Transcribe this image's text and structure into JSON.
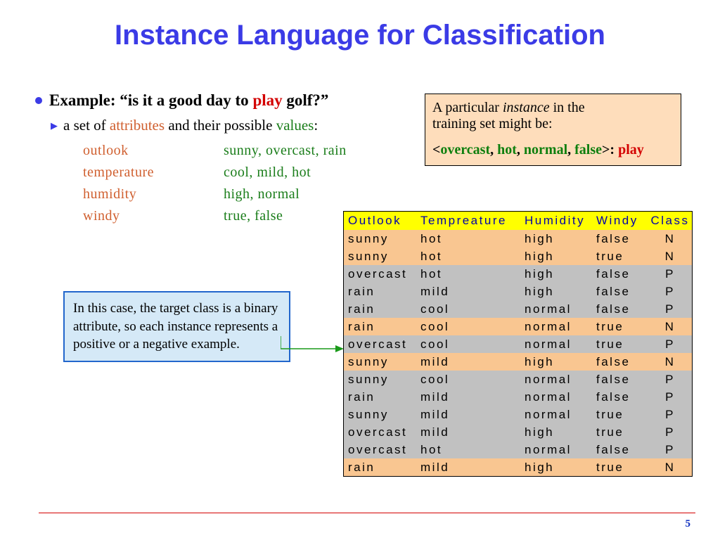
{
  "title": "Instance Language for Classification",
  "example": {
    "prefix": "Example: “is it a good day to ",
    "play": "play",
    "suffix": " golf?”"
  },
  "subline": {
    "p1": "a set of ",
    "attributes": "attributes",
    "p2": " and their possible ",
    "values": "values",
    "p3": ":"
  },
  "attrs": [
    {
      "name": "outlook",
      "vals": "sunny, overcast, rain"
    },
    {
      "name": "temperature",
      "vals": "cool, mild, hot"
    },
    {
      "name": "humidity",
      "vals": "high, normal"
    },
    {
      "name": "windy",
      "vals": "true, false"
    }
  ],
  "instance_box": {
    "l1a": "A particular ",
    "l1b": "instance",
    "l1c": " in the",
    "l2": "training set might be:",
    "bracket_open": "<",
    "vals": [
      "overcast",
      "hot",
      "normal",
      "false"
    ],
    "sep": ", ",
    "bracket_close": ">: ",
    "label": "play"
  },
  "note_box": "In this case, the target class is a binary attribute, so each instance represents a positive or a negative example.",
  "table": {
    "headers": [
      "Outlook",
      "Tempreature",
      "Humidity",
      "Windy",
      "Class"
    ],
    "rows": [
      {
        "c": [
          "sunny",
          "hot",
          "high",
          "false",
          "N"
        ],
        "band": "orange"
      },
      {
        "c": [
          "sunny",
          "hot",
          "high",
          "true",
          "N"
        ],
        "band": "orange"
      },
      {
        "c": [
          "overcast",
          "hot",
          "high",
          "false",
          "P"
        ],
        "band": "gray"
      },
      {
        "c": [
          "rain",
          "mild",
          "high",
          "false",
          "P"
        ],
        "band": "gray"
      },
      {
        "c": [
          "rain",
          "cool",
          "normal",
          "false",
          "P"
        ],
        "band": "gray"
      },
      {
        "c": [
          "rain",
          "cool",
          "normal",
          "true",
          "N"
        ],
        "band": "orange"
      },
      {
        "c": [
          "overcast",
          "cool",
          "normal",
          "true",
          "P"
        ],
        "band": "gray"
      },
      {
        "c": [
          "sunny",
          "mild",
          "high",
          "false",
          "N"
        ],
        "band": "orange"
      },
      {
        "c": [
          "sunny",
          "cool",
          "normal",
          "false",
          "P"
        ],
        "band": "gray"
      },
      {
        "c": [
          "rain",
          "mild",
          "normal",
          "false",
          "P"
        ],
        "band": "gray"
      },
      {
        "c": [
          "sunny",
          "mild",
          "normal",
          "true",
          "P"
        ],
        "band": "gray"
      },
      {
        "c": [
          "overcast",
          "mild",
          "high",
          "true",
          "P"
        ],
        "band": "gray"
      },
      {
        "c": [
          "overcast",
          "hot",
          "normal",
          "false",
          "P"
        ],
        "band": "gray"
      },
      {
        "c": [
          "rain",
          "mild",
          "high",
          "true",
          "N"
        ],
        "band": "orange"
      }
    ]
  },
  "page_number": "5",
  "chart_data": {
    "type": "table",
    "title": "Instance Language for Classification — training table",
    "columns": [
      "Outlook",
      "Tempreature",
      "Humidity",
      "Windy",
      "Class"
    ],
    "rows": [
      [
        "sunny",
        "hot",
        "high",
        "false",
        "N"
      ],
      [
        "sunny",
        "hot",
        "high",
        "true",
        "N"
      ],
      [
        "overcast",
        "hot",
        "high",
        "false",
        "P"
      ],
      [
        "rain",
        "mild",
        "high",
        "false",
        "P"
      ],
      [
        "rain",
        "cool",
        "normal",
        "false",
        "P"
      ],
      [
        "rain",
        "cool",
        "normal",
        "true",
        "N"
      ],
      [
        "overcast",
        "cool",
        "normal",
        "true",
        "P"
      ],
      [
        "sunny",
        "mild",
        "high",
        "false",
        "N"
      ],
      [
        "sunny",
        "cool",
        "normal",
        "false",
        "P"
      ],
      [
        "rain",
        "mild",
        "normal",
        "false",
        "P"
      ],
      [
        "sunny",
        "mild",
        "normal",
        "true",
        "P"
      ],
      [
        "overcast",
        "mild",
        "high",
        "true",
        "P"
      ],
      [
        "overcast",
        "hot",
        "normal",
        "false",
        "P"
      ],
      [
        "rain",
        "mild",
        "high",
        "true",
        "N"
      ]
    ]
  }
}
